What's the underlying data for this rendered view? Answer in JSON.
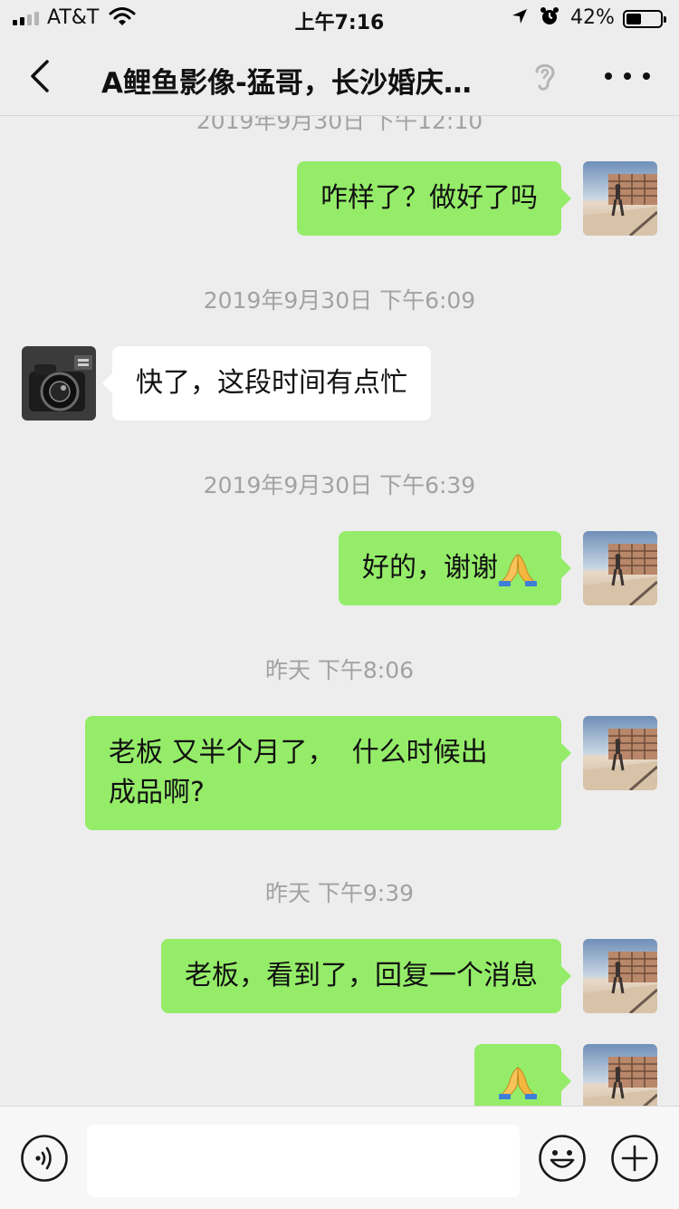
{
  "status_bar": {
    "carrier": "AT&T",
    "time": "上午7:16",
    "battery_percent": "42%",
    "battery_level": 0.42,
    "signal_bars_active": 2,
    "signal_bars_total": 4
  },
  "nav": {
    "title": "A鲤鱼影像-猛哥，长沙婚庆…"
  },
  "chat": {
    "partial_timestamp": "2019年9月30日 下午12:10",
    "timestamps": [
      "2019年9月30日 下午6:09",
      "2019年9月30日 下午6:39",
      "昨天 下午8:06",
      "昨天 下午9:39"
    ],
    "messages": [
      {
        "sender": "me",
        "text": "咋样了？做好了吗"
      },
      {
        "sender": "them",
        "text": "快了，这段时间有点忙"
      },
      {
        "sender": "me",
        "text": "好的，谢谢",
        "emoji": "folded-hands"
      },
      {
        "sender": "me",
        "line1": "老板 又半个月了，  什么时候出",
        "line2": "成品啊?"
      },
      {
        "sender": "me",
        "text": "老板，看到了，回复一个消息"
      },
      {
        "sender": "me",
        "text": "",
        "emoji": "folded-hands"
      }
    ]
  },
  "input_bar": {
    "placeholder": "",
    "icons": [
      "voice-icon",
      "emoji-icon",
      "plus-icon"
    ]
  },
  "colors": {
    "background": "#ededed",
    "my_bubble": "#95ec69",
    "their_bubble": "#ffffff",
    "timestamp_text": "#a2a2a2"
  }
}
